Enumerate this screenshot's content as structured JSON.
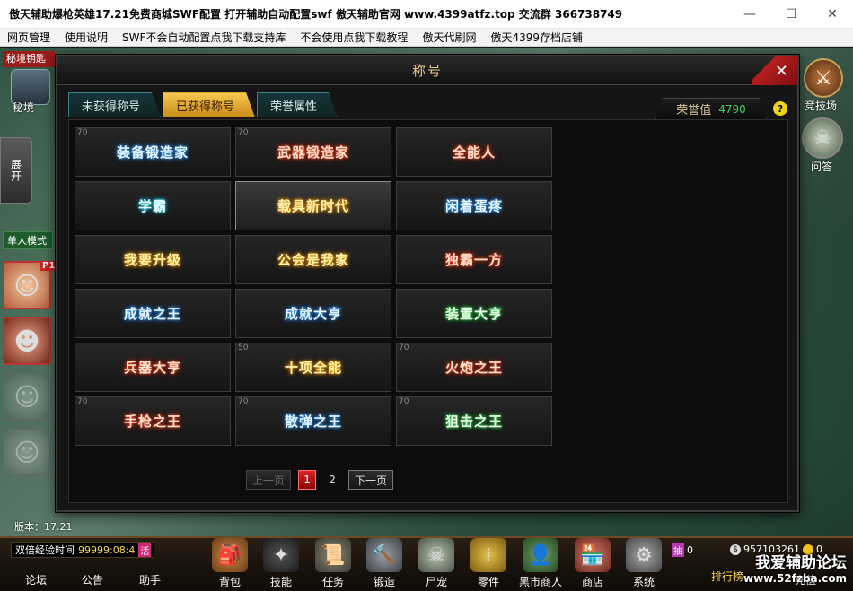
{
  "window": {
    "title": "傲天辅助爆枪英雄17.21免费商城SWF配置  打开辅助自动配置swf  傲天辅助官网 www.4399atfz.top 交流群 366738749",
    "minimize": "—",
    "maximize": "☐",
    "close": "✕"
  },
  "menu": [
    "网页管理",
    "使用说明",
    "SWF不会自动配置点我下载支持库",
    "不会使用点我下载教程",
    "傲天代刷网",
    "傲天4399存档店铺"
  ],
  "left_panel": {
    "secret_key_tab": "秘境钥匙",
    "secret_label": "秘境",
    "expand_label": "展开",
    "single_mode": "单人模式",
    "p1_badge": "P1"
  },
  "right_panel": {
    "arena_label": "竞技场",
    "quiz_label": "问答"
  },
  "dialog": {
    "title": "称号",
    "close_label": "✕",
    "tabs": [
      "未获得称号",
      "已获得称号",
      "荣誉属性"
    ],
    "active_tab": 1,
    "honor_label": "荣誉值",
    "honor_value": "4790",
    "help_label": "?",
    "titles": [
      {
        "name": "装备锻造家",
        "level": "70",
        "style": "blue"
      },
      {
        "name": "武器锻造家",
        "level": "70",
        "style": "red"
      },
      {
        "name": "全能人",
        "level": "",
        "style": "red"
      },
      {
        "name": "学霸",
        "level": "",
        "style": "cyan"
      },
      {
        "name": "载具新时代",
        "level": "",
        "style": "gold"
      },
      {
        "name": "闲着蛋疼",
        "level": "",
        "style": "blue"
      },
      {
        "name": "我要升级",
        "level": "",
        "style": "gold"
      },
      {
        "name": "公会是我家",
        "level": "",
        "style": "gold"
      },
      {
        "name": "独霸一方",
        "level": "",
        "style": "red"
      },
      {
        "name": "成就之王",
        "level": "",
        "style": "blue"
      },
      {
        "name": "成就大亨",
        "level": "",
        "style": "blue"
      },
      {
        "name": "装置大亨",
        "level": "",
        "style": "green"
      },
      {
        "name": "兵器大亨",
        "level": "",
        "style": "red"
      },
      {
        "name": "十项全能",
        "level": "50",
        "style": "gold"
      },
      {
        "name": "火炮之王",
        "level": "70",
        "style": "red"
      },
      {
        "name": "手枪之王",
        "level": "70",
        "style": "red"
      },
      {
        "name": "散弹之王",
        "level": "70",
        "style": "blue"
      },
      {
        "name": "狙击之王",
        "level": "70",
        "style": "green"
      }
    ],
    "pager": {
      "prev": "上一页",
      "pages": [
        "1",
        "2"
      ],
      "current": "1",
      "next": "下一页"
    }
  },
  "hud": {
    "version": "版本：17.21",
    "exp_label": "双倍经验时间",
    "exp_value": "99999:08:4",
    "exp_icon": "活",
    "left_buttons": [
      "论坛",
      "公告",
      "助手"
    ],
    "buttons": [
      {
        "label": "背包",
        "icon": "backpack-icon"
      },
      {
        "label": "技能",
        "icon": "skill-icon"
      },
      {
        "label": "任务",
        "icon": "task-scroll-icon"
      },
      {
        "label": "锻造",
        "icon": "hammer-icon"
      },
      {
        "label": "尸宠",
        "icon": "zombie-pet-icon"
      },
      {
        "label": "零件",
        "icon": "bullets-icon"
      },
      {
        "label": "黑市商人",
        "icon": "merchant-icon"
      },
      {
        "label": "商店",
        "icon": "shop-icon"
      },
      {
        "label": "系统",
        "icon": "gear-icon"
      }
    ],
    "currency_1": "0",
    "currency_1_icon": "抽",
    "currency_2": "957103261",
    "currency_2_icon": "$",
    "currency_3": "0",
    "rank": "排行榜",
    "recharge": "充值"
  },
  "watermark": {
    "line1": "我爱辅助论坛",
    "line2": "www.52fzba.com"
  }
}
